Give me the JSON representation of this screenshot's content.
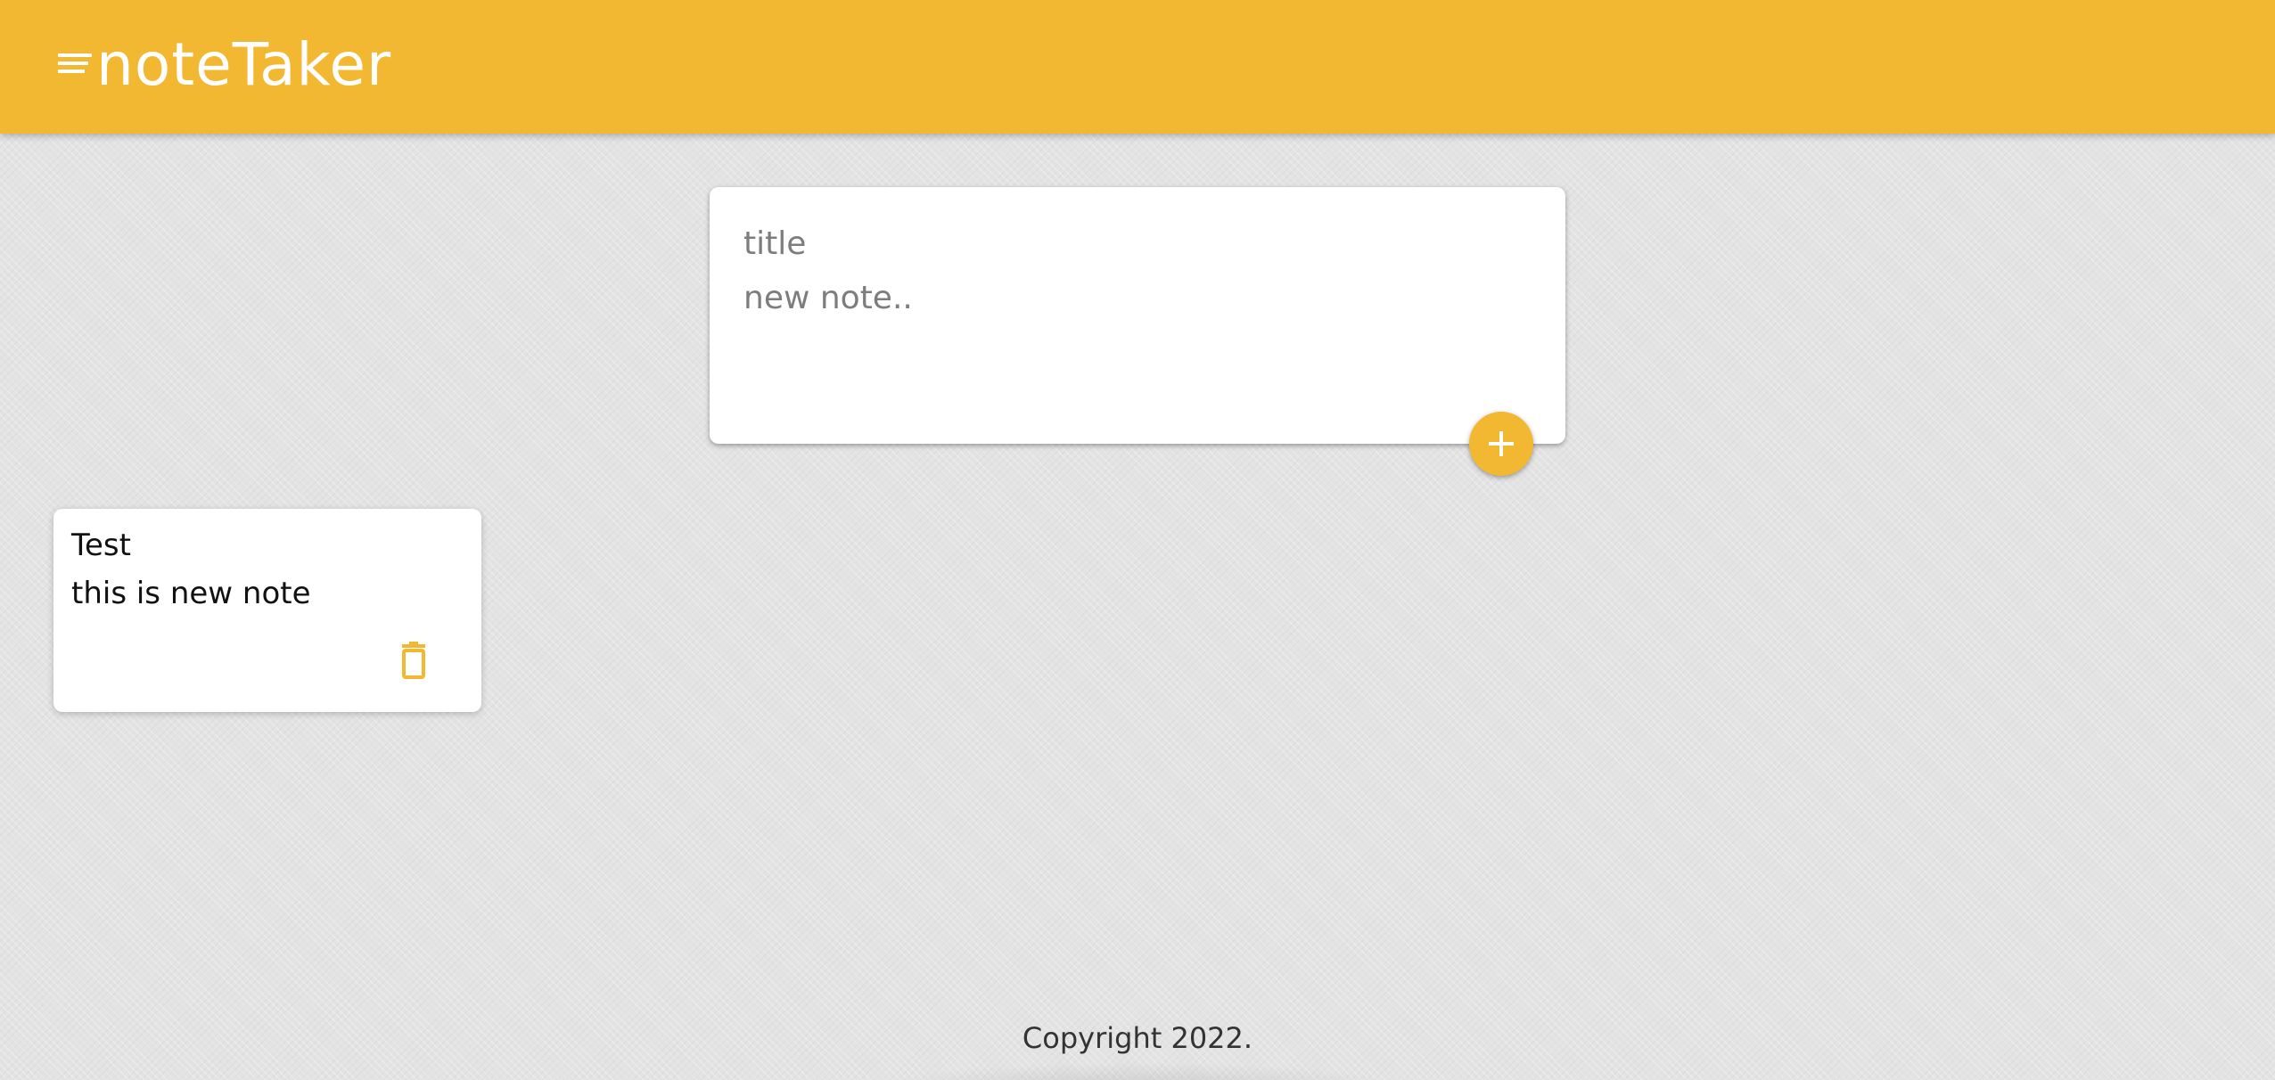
{
  "header": {
    "app_title": "noteTaker",
    "menu_icon": "menu-lines-icon",
    "background_color": "#f3b832"
  },
  "create_note": {
    "title_placeholder": "title",
    "content_placeholder": "new note..",
    "add_icon": "plus-icon"
  },
  "notes": [
    {
      "title": "Test",
      "content": "this is new note",
      "delete_icon": "trash-icon"
    }
  ],
  "footer": {
    "copyright": "Copyright 2022."
  },
  "colors": {
    "accent": "#f3b832",
    "card": "#ffffff",
    "text": "#111111"
  }
}
